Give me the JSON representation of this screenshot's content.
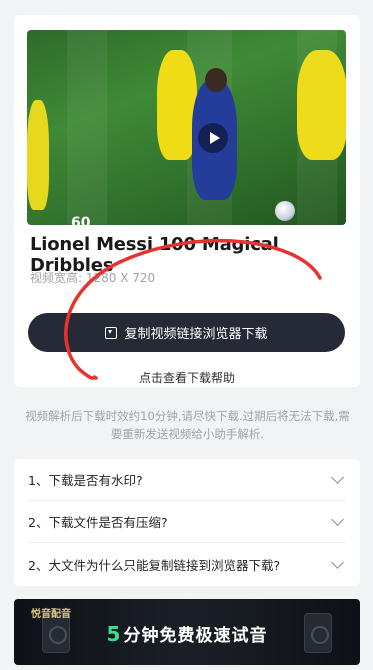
{
  "video": {
    "title": "Lionel Messi 100 Magical Dribbles",
    "resolution": "视频宽高: 1280 X 720",
    "overlay_text": "60"
  },
  "actions": {
    "download_button_label": "复制视频链接浏览器下载",
    "help_link_label": "点击查看下载帮助"
  },
  "notice": "视频解析后下载时效约10分钟,请尽快下载.过期后将无法下载,需要重新发送视频给小助手解析.",
  "faq": [
    {
      "label": "1、下载是否有水印?"
    },
    {
      "label": "2、下载文件是否有压缩?"
    },
    {
      "label": "2、大文件为什么只能复制链接到浏览器下载?"
    }
  ],
  "banner": {
    "brand": "悦音配音",
    "number": "5",
    "text": "分钟免费极速试音"
  },
  "colors": {
    "button_bg": "#262a36",
    "annotation_red": "#e8322f",
    "banner_accent": "#3ce08a"
  }
}
